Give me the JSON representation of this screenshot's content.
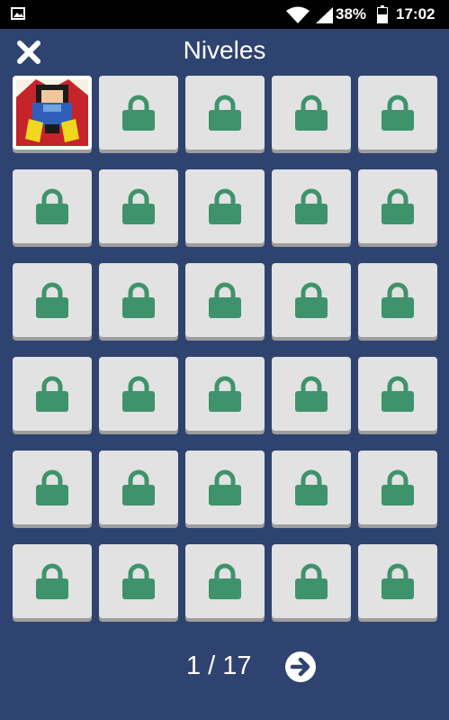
{
  "status_bar": {
    "battery_percent": "38%",
    "time": "17:02",
    "icons": [
      "image-icon",
      "wifi-icon",
      "signal-icon",
      "battery-icon"
    ]
  },
  "header": {
    "title": "Niveles",
    "close_icon": "close-icon"
  },
  "levels": {
    "total": 30,
    "unlocked": [
      1
    ],
    "locked_icon": "lock-icon",
    "lock_color": "#3f936c"
  },
  "pager": {
    "current": "1 / 17",
    "next_icon": "arrow-right-circle-icon"
  },
  "colors": {
    "background": "#2f4370",
    "tile": "#e2e2e2",
    "tile_shadow": "#9d9d9d"
  }
}
